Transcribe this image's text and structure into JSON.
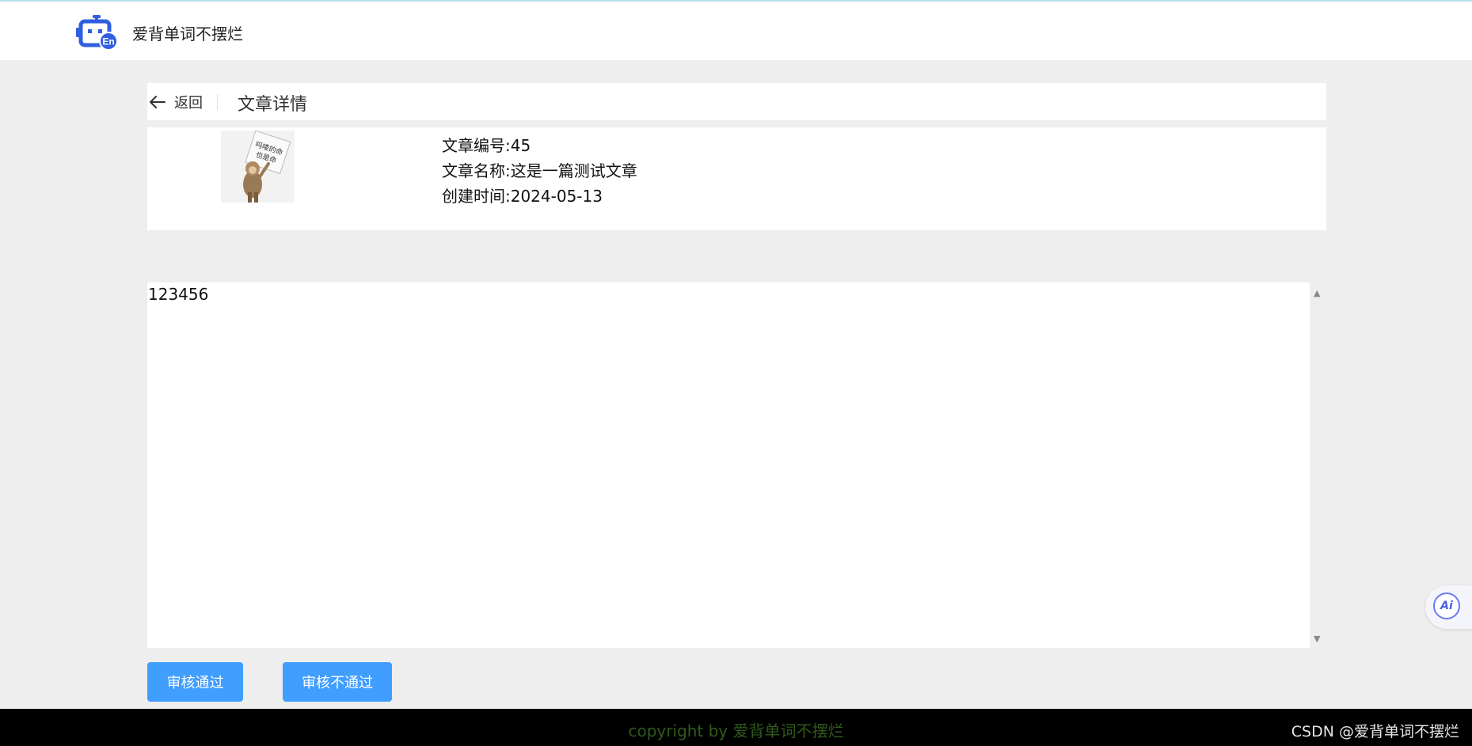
{
  "header": {
    "app_title": "爱背单词不摆烂",
    "logo_icon": "robot-en-icon",
    "logo_color": "#2f5fe0"
  },
  "page_header": {
    "back_label": "返回",
    "title": "文章详情"
  },
  "article": {
    "id_line": "文章编号:45",
    "name_line": "文章名称:这是一篇测试文章",
    "created_line": "创建时间:2024-05-13",
    "thumbnail_text": "吗喽的命也是命"
  },
  "content": {
    "text": "123456"
  },
  "actions": {
    "approve_label": "审核通过",
    "reject_label": "审核不通过",
    "button_color": "#409eff"
  },
  "footer": {
    "copyright": "copyright by 爱背单词不摆烂",
    "watermark": "CSDN @爱背单词不摆烂"
  },
  "ai_fab": {
    "label": "Ai"
  }
}
